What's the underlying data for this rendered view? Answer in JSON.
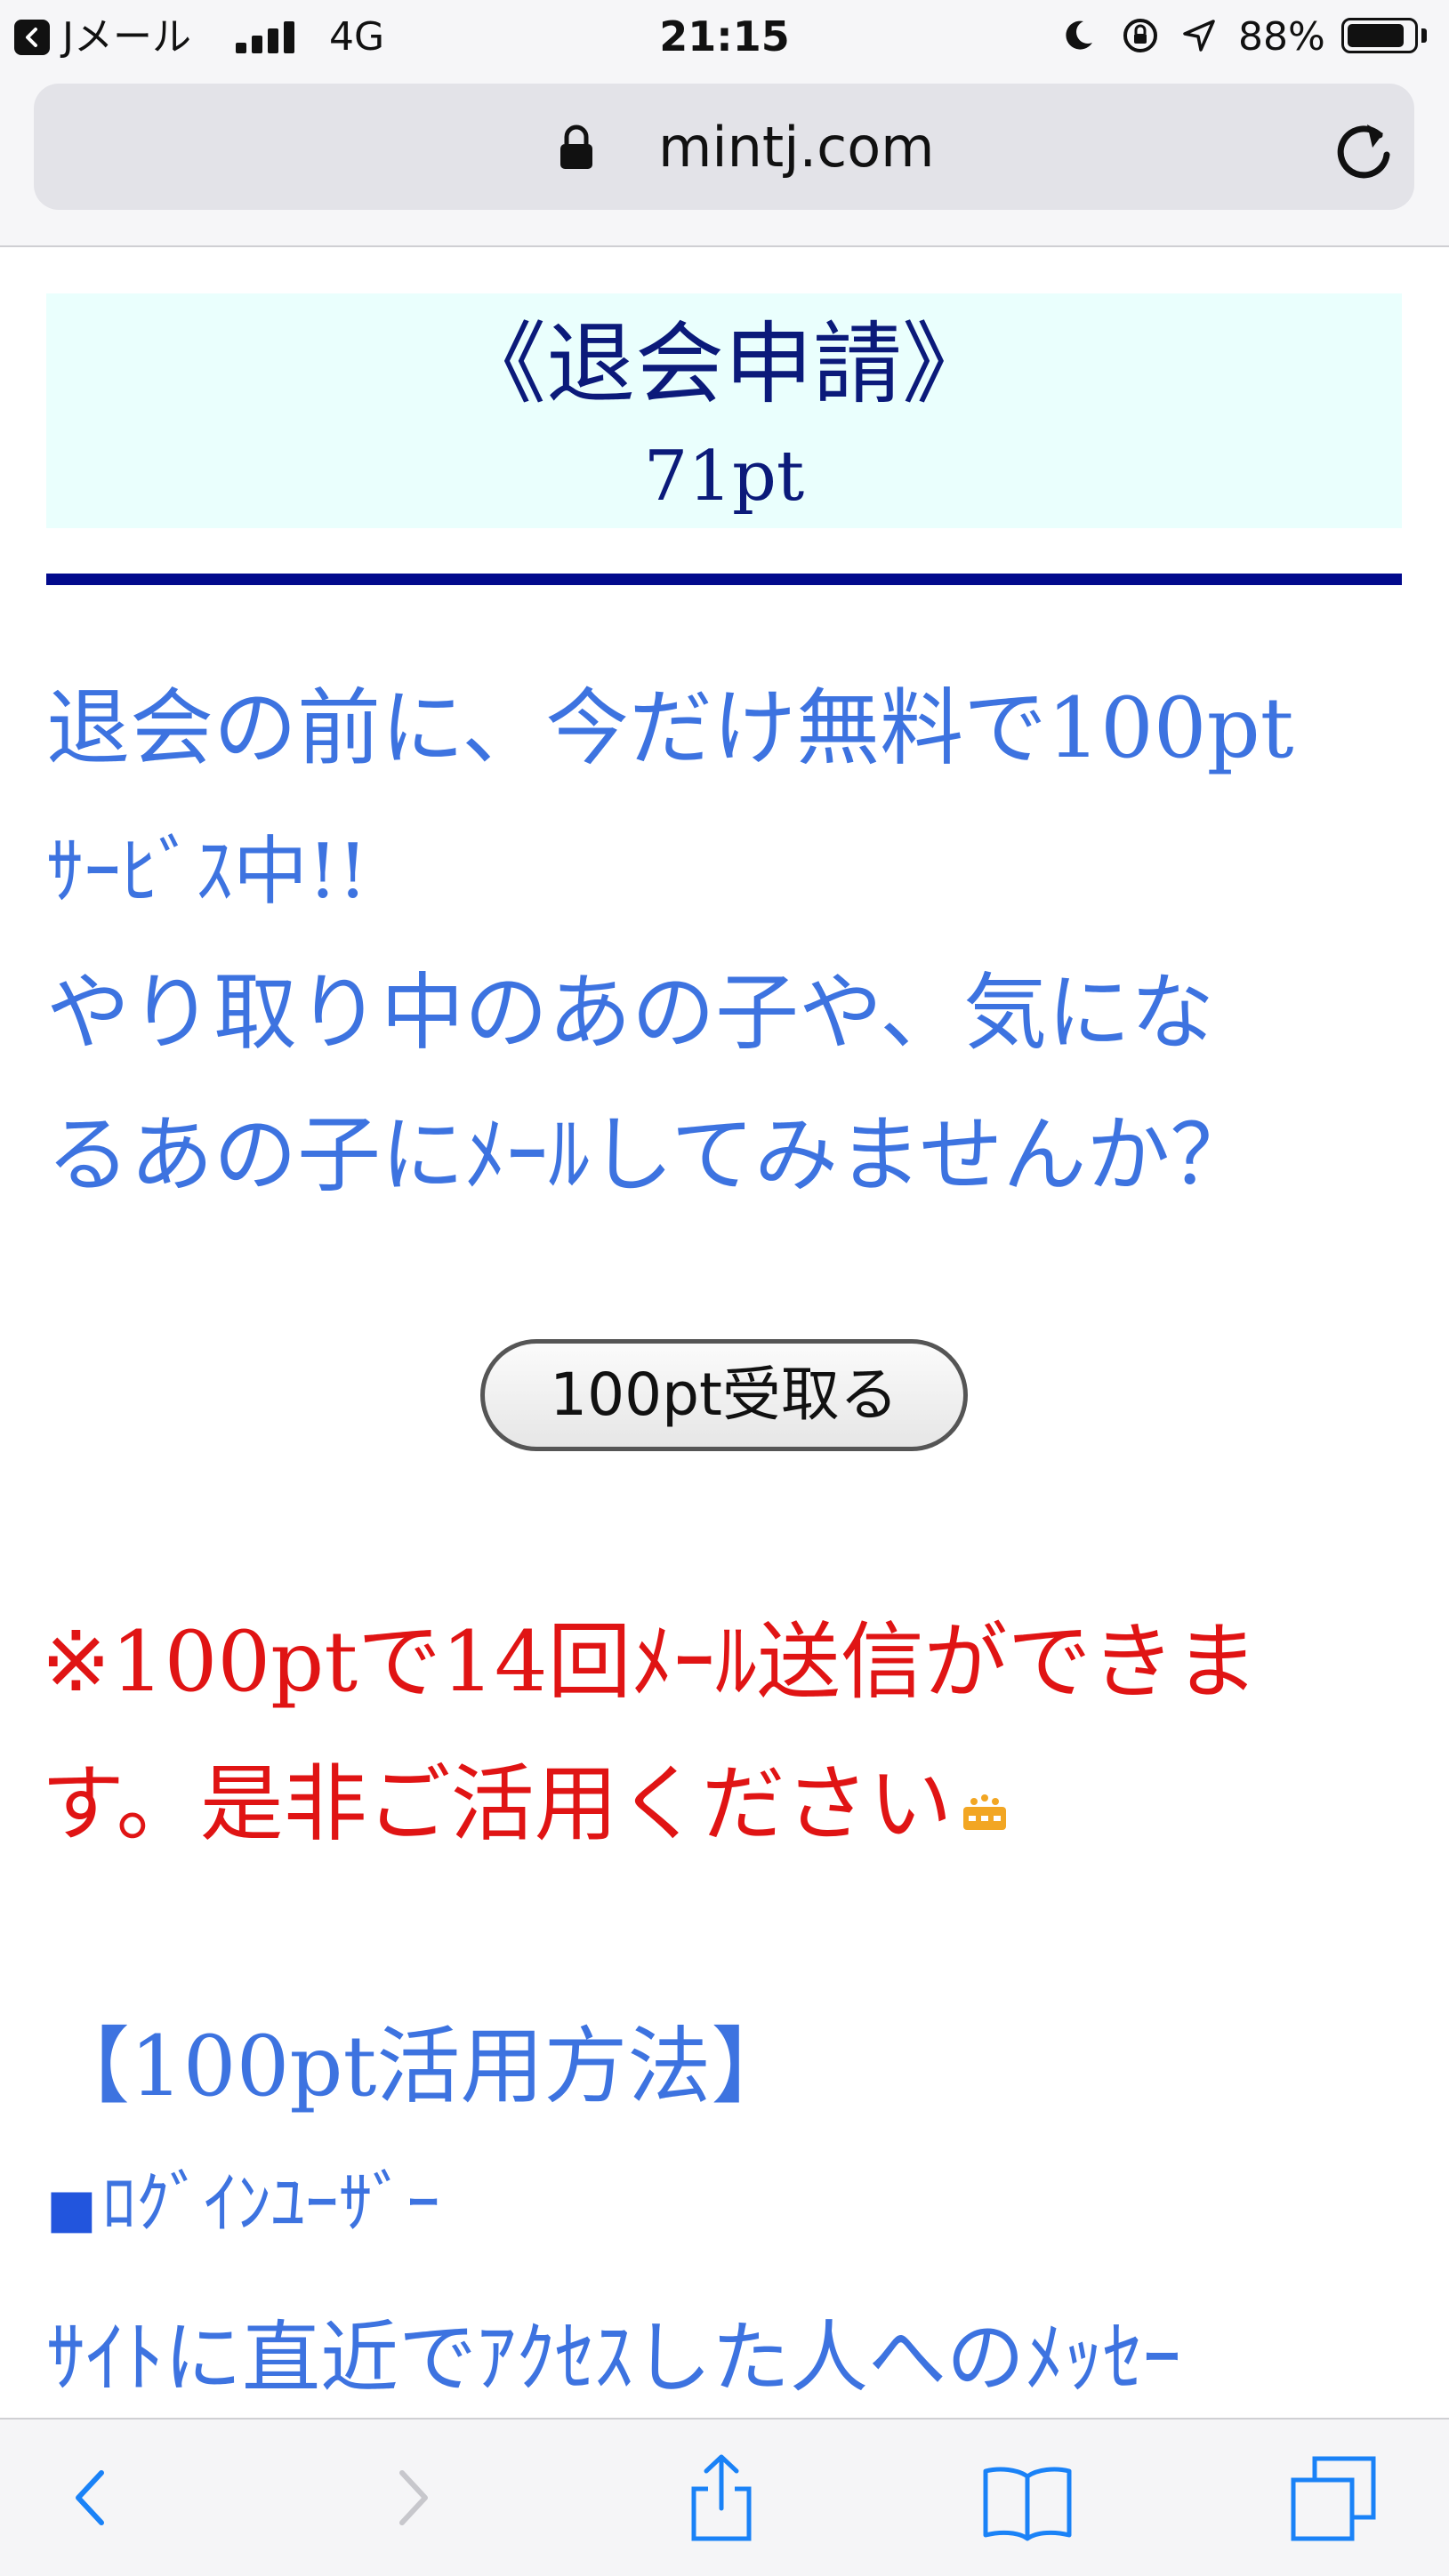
{
  "status_bar": {
    "carrier": "Jメール",
    "network": "4G",
    "time": "21:15",
    "battery": "88%",
    "battery_level": 0.88
  },
  "browser": {
    "url": "mintj.com"
  },
  "page": {
    "title": "《退会申請》",
    "points": "71pt",
    "promo_lines": [
      "退会の前に、今だけ無料で100pt",
      "ｻｰﾋﾞｽ中!!",
      "やり取り中のあの子や、気にな",
      "るあの子にﾒｰﾙしてみませんか？"
    ],
    "receive_button": "100pt受取る",
    "notice_lines": [
      "※100ptで14回ﾒｰﾙ送信ができま",
      "す。是非ご活用ください"
    ],
    "howto_title": "【100pt活用方法】",
    "login_user": "ﾛｸﾞｲﾝﾕｰｻﾞｰ",
    "description": "ｻｲﾄに直近でｱｸｾｽした人へのﾒｯｾｰ"
  },
  "colors": {
    "title": "#0b1a7a",
    "promo": "#3d73e0",
    "notice": "#e01414",
    "ios_blue": "#1a82f7"
  },
  "icons": [
    "back-carrier-icon",
    "signal-icon",
    "moon-icon",
    "rotation-lock-icon",
    "location-icon",
    "battery-icon",
    "lock-icon",
    "reload-icon",
    "emoji-icon",
    "back-icon",
    "forward-icon",
    "share-icon",
    "bookmarks-icon",
    "tabs-icon"
  ]
}
